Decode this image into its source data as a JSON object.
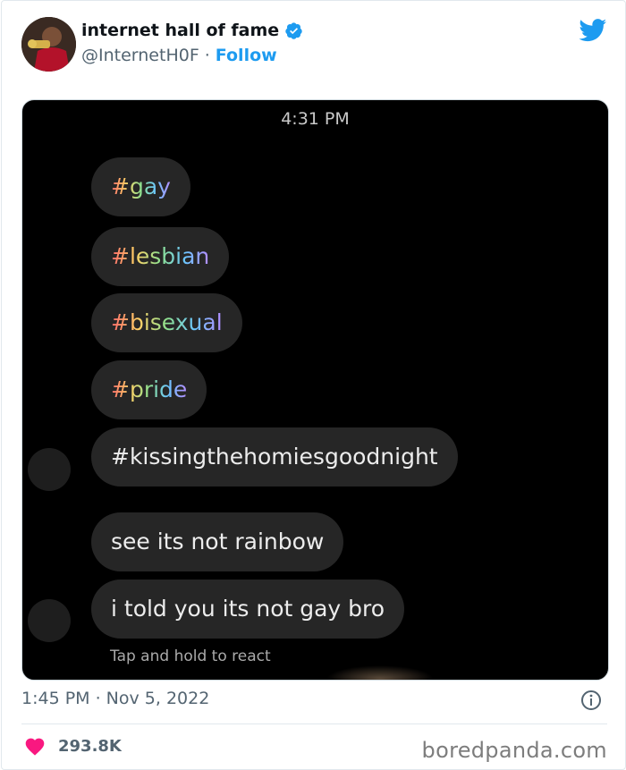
{
  "tweet": {
    "display_name": "internet hall of fame",
    "handle": "@InternetH0F",
    "separator": "·",
    "follow_label": "Follow",
    "timestamp": "1:45 PM · Nov 5, 2022",
    "likes": "293.8K"
  },
  "screenshot": {
    "time": "4:31 PM",
    "messages": [
      {
        "text": "#gay",
        "style": "rainbow"
      },
      {
        "text": "#lesbian",
        "style": "rainbow"
      },
      {
        "text": "#bisexual",
        "style": "rainbow"
      },
      {
        "text": "#pride",
        "style": "rainbow"
      },
      {
        "text": "#kissingthehomiesgoodnight",
        "style": "plain"
      },
      {
        "text": "see its not rainbow",
        "style": "plain"
      },
      {
        "text": "i told you its not gay bro",
        "style": "plain"
      }
    ],
    "hint": "Tap and hold to react"
  },
  "watermark": "boredpanda.com",
  "colors": {
    "twitter_blue": "#1d9bf0",
    "heart": "#f91880",
    "bubble": "#262626"
  },
  "icons": [
    "verified-badge-icon",
    "twitter-bird-icon",
    "info-icon",
    "heart-icon"
  ]
}
